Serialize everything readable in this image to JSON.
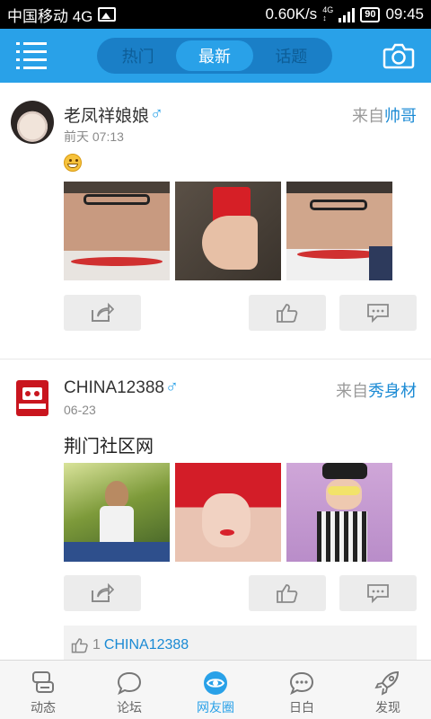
{
  "status_bar": {
    "carrier": "中国移动 4G",
    "speed": "0.60K/s",
    "network": "4G",
    "battery": "90",
    "time": "09:45"
  },
  "header": {
    "tabs": [
      {
        "label": "热门",
        "active": false
      },
      {
        "label": "最新",
        "active": true
      },
      {
        "label": "话题",
        "active": false
      }
    ],
    "menu_icon": "menu-icon",
    "camera_icon": "camera-icon",
    "accent_color": "#29a1e8"
  },
  "posts": [
    {
      "username": "老凤祥娘娘",
      "gender_symbol": "♂",
      "time": "前天 07:13",
      "source_prefix": "来自",
      "source_topic": "帅哥",
      "content_emoji": "grinning-emoji",
      "photos": [
        "photo-man-grimace",
        "photo-cola-can",
        "photo-man-glasses"
      ]
    },
    {
      "username": "CHINA12388",
      "gender_symbol": "♂",
      "time": "06-23",
      "source_prefix": "来自",
      "source_topic": "秀身材",
      "content_text": "荆门社区网",
      "photos": [
        "photo-woman-park",
        "photo-woman-red-hat",
        "photo-woman-sunglasses"
      ],
      "like_count": "1",
      "likers": "CHINA12388"
    }
  ],
  "bottom_nav": [
    {
      "label": "动态",
      "icon": "feed-icon",
      "active": false
    },
    {
      "label": "论坛",
      "icon": "forum-icon",
      "active": false
    },
    {
      "label": "网友圈",
      "icon": "eye-icon",
      "active": true
    },
    {
      "label": "日白",
      "icon": "chat-icon",
      "active": false
    },
    {
      "label": "发现",
      "icon": "rocket-icon",
      "active": false
    }
  ]
}
